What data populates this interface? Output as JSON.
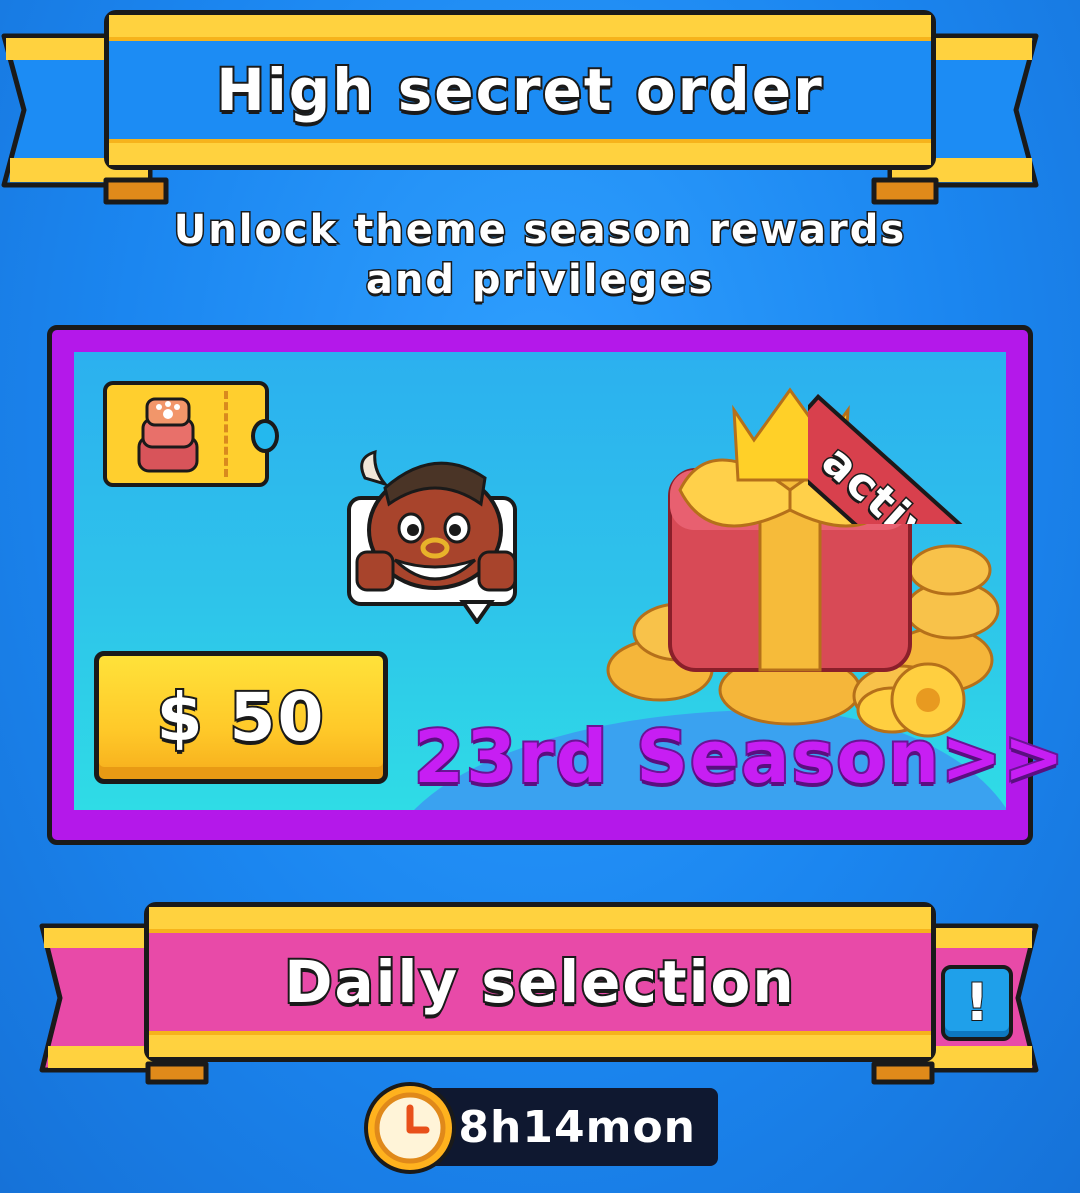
{
  "header": {
    "title": "High secret order",
    "subtitle_line1": "Unlock theme season rewards",
    "subtitle_line2": "and privileges"
  },
  "season_card": {
    "price": "$ 50",
    "status": "active",
    "season_link": "23rd Season>>"
  },
  "daily": {
    "title": "Daily selection",
    "info_glyph": "!",
    "timer": "8h14mon"
  },
  "icons": [
    "paw-ticket-icon",
    "bull-avatar-icon",
    "gift-box-icon",
    "coin-pile-icon",
    "info-icon",
    "clock-icon"
  ],
  "colors": {
    "background": "#1b86f0",
    "ribbon_blue": "#1c8cf4",
    "ribbon_pink": "#e84aa8",
    "ribbon_gold": "#ffd23f",
    "card_frame": "#b418ea",
    "price_button": "#ffc929",
    "active_sash": "#d8404d",
    "season_text": "#c71ef3"
  }
}
